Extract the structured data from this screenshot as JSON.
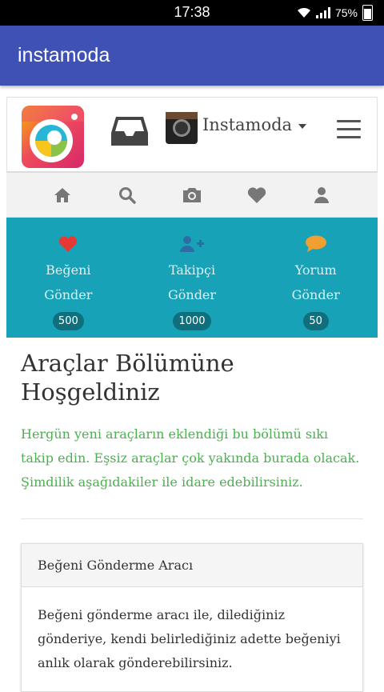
{
  "status_bar": {
    "time": "17:38",
    "battery": "75%"
  },
  "app_bar": {
    "title": "instamoda"
  },
  "top_nav": {
    "username": "Instamoda"
  },
  "icon_bar": [
    "home-icon",
    "search-icon",
    "camera-icon",
    "heart-icon",
    "user-icon"
  ],
  "services": [
    {
      "line1": "Beğeni",
      "line2": "Gönder",
      "count": "500",
      "icon": "heart-icon",
      "color": "#e53935"
    },
    {
      "line1": "Takipçi",
      "line2": "Gönder",
      "count": "1000",
      "icon": "user-plus-icon",
      "color": "#2e6da4"
    },
    {
      "line1": "Yorum",
      "line2": "Gönder",
      "count": "50",
      "icon": "comment-icon",
      "color": "#f0a030"
    }
  ],
  "main": {
    "heading": "Araçlar Bölümüne Hoşgeldiniz",
    "intro": "Hergün yeni araçların eklendiği bu bölümü sıkı takip edin. Eşsiz araçlar çok yakında burada olacak. Şimdilik aşağıdakiler ile idare edebilirsiniz.",
    "card_title": "Beğeni Gönderme Aracı",
    "card_body": "Beğeni gönderme aracı ile, dilediğiniz gönderiye, kendi belirlediğiniz adette beğeniyi anlık olarak gönderebilirsiniz."
  },
  "colors": {
    "app_bar": "#3f51b5",
    "teal": "#17a2b8",
    "intro_text": "#4caf50"
  }
}
